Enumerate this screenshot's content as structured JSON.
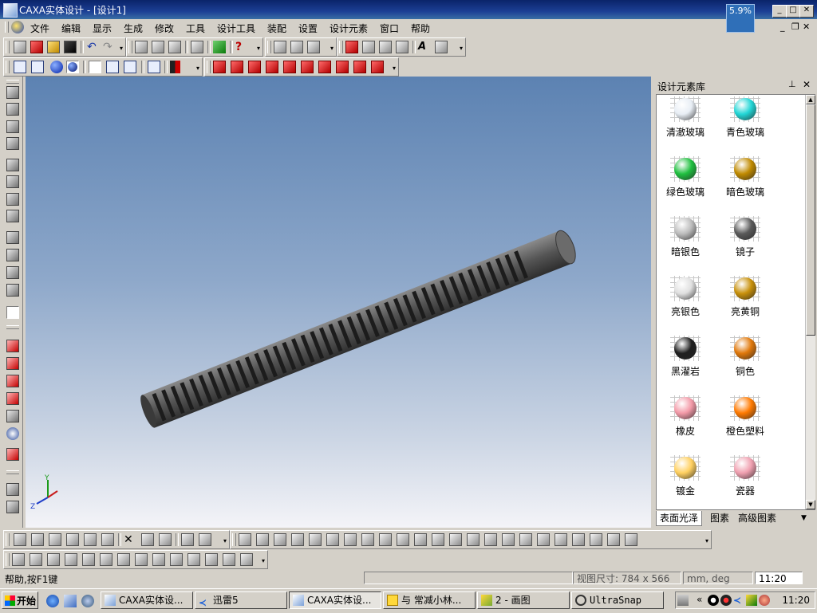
{
  "window": {
    "title": "CAXA实体设计 - [设计1]",
    "cpu_badge": "5.9%",
    "min": "_",
    "max": "□",
    "close": "✕"
  },
  "menu": [
    "文件",
    "编辑",
    "显示",
    "生成",
    "修改",
    "工具",
    "设计工具",
    "装配",
    "设置",
    "设计元素",
    "窗口",
    "帮助"
  ],
  "panel": {
    "title": "设计元素库",
    "pin": "📌",
    "close": "✕",
    "materials": [
      {
        "label": "清澈玻璃",
        "color": "#e8eef5"
      },
      {
        "label": "青色玻璃",
        "color": "#22d6d6"
      },
      {
        "label": "绿色玻璃",
        "color": "#20c040"
      },
      {
        "label": "暗色玻璃",
        "color": "#c08a00"
      },
      {
        "label": "暗银色",
        "color": "#bdbdbd"
      },
      {
        "label": "镜子",
        "color": "#5a5a5a"
      },
      {
        "label": "亮银色",
        "color": "#e0e0e0"
      },
      {
        "label": "亮黄铜",
        "color": "#c8900a"
      },
      {
        "label": "黑濯岩",
        "color": "#202020"
      },
      {
        "label": "铜色",
        "color": "#e0780a"
      },
      {
        "label": "橡皮",
        "color": "#f39aa8"
      },
      {
        "label": "橙色塑料",
        "color": "#ff7a00"
      },
      {
        "label": "镀金",
        "color": "#ffd060"
      },
      {
        "label": "瓷器",
        "color": "#f0a0b0"
      }
    ],
    "tabs": [
      "表面光泽",
      "图素",
      "高级图素"
    ],
    "tab_menu": "▼"
  },
  "axes": {
    "y": "Y",
    "z": "Z"
  },
  "status": {
    "help": "帮助,按F1键",
    "view_size": "视图尺寸: 784 x 566",
    "units": "mm, deg",
    "time": "11:20"
  },
  "taskbar": {
    "start": "开始",
    "tasks": [
      "CAXA实体设...",
      "迅雷5",
      "CAXA实体设...",
      "与 常减小林...",
      "2 - 画图",
      "UltraSnap"
    ],
    "clock": "11:20",
    "tray_arrow": "«"
  }
}
